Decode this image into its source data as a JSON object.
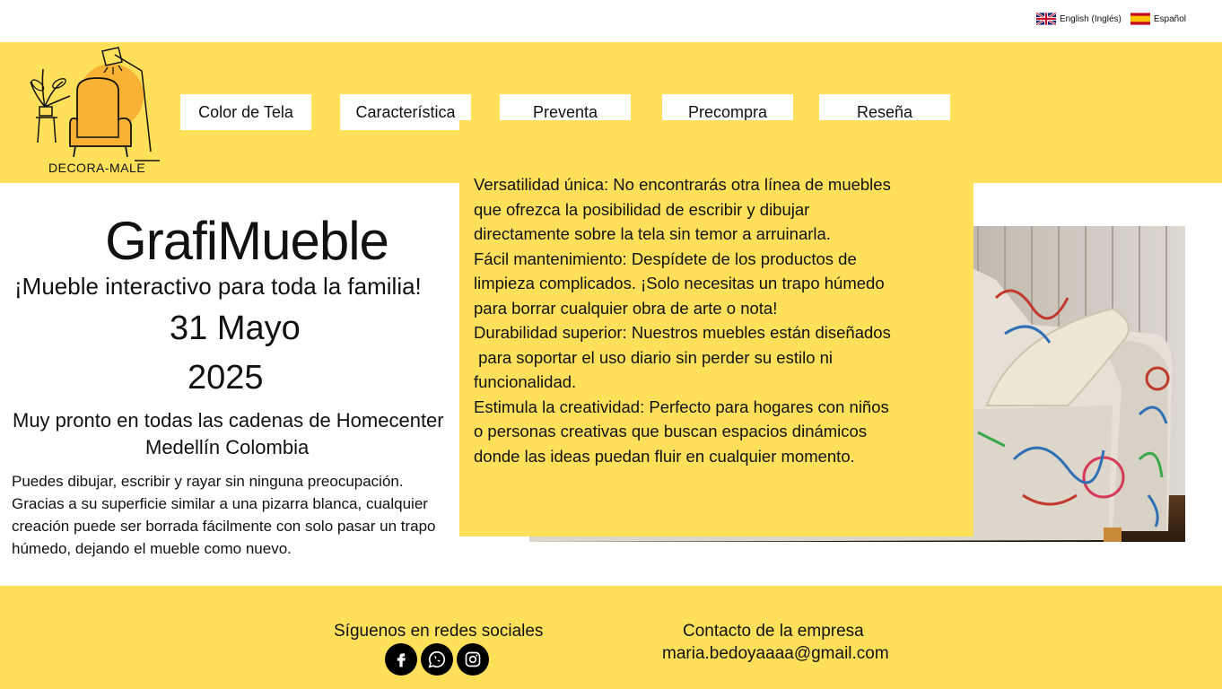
{
  "language": {
    "english": "English (Inglés)",
    "spanish": "Español"
  },
  "brand": {
    "name": "DECORA-MALE"
  },
  "nav": {
    "items": [
      "Color de Tela",
      "Característica",
      "Preventa",
      "Precompra",
      "Reseña"
    ]
  },
  "hero": {
    "title": "GrafiMueble",
    "subtitle": "¡Mueble interactivo para toda la familia!",
    "date_line1": "31 Mayo",
    "date_line2": "2025",
    "soon": "Muy pronto en todas las cadenas de Homecenter",
    "city": "Medellín Colombia",
    "description": [
      "Puedes dibujar, escribir y rayar sin ninguna preocupación.",
      "Gracias a su superficie similar a una pizarra blanca, cualquier",
      "creación puede ser borrada fácilmente con solo pasar un trapo",
      "húmedo, dejando el mueble como nuevo."
    ]
  },
  "features": {
    "lines": [
      "Versatilidad única: No encontrarás otra línea de muebles",
      "que ofrezca la posibilidad de escribir y dibujar",
      "directamente sobre la tela sin temor a arruinarla.",
      "Fácil mantenimiento: Despídete de los productos de",
      "limpieza complicados. ¡Solo necesitas un trapo húmedo",
      "para borrar cualquier obra de arte o nota!",
      "Durabilidad superior: Nuestros muebles están diseñados",
      " para soportar el uso diario sin perder su estilo ni",
      "funcionalidad.",
      "Estimula la creatividad: Perfecto para hogares con niños",
      "o personas creativas que buscan espacios dinámicos",
      "donde las ideas puedan fluir en cualquier momento."
    ]
  },
  "footer": {
    "social_title": "Síguenos en redes sociales",
    "contact_title": "Contacto de la empresa",
    "email": "maria.bedoyaaaa@gmail.com"
  },
  "colors": {
    "accent": "#ffe05a",
    "text": "#111111"
  }
}
